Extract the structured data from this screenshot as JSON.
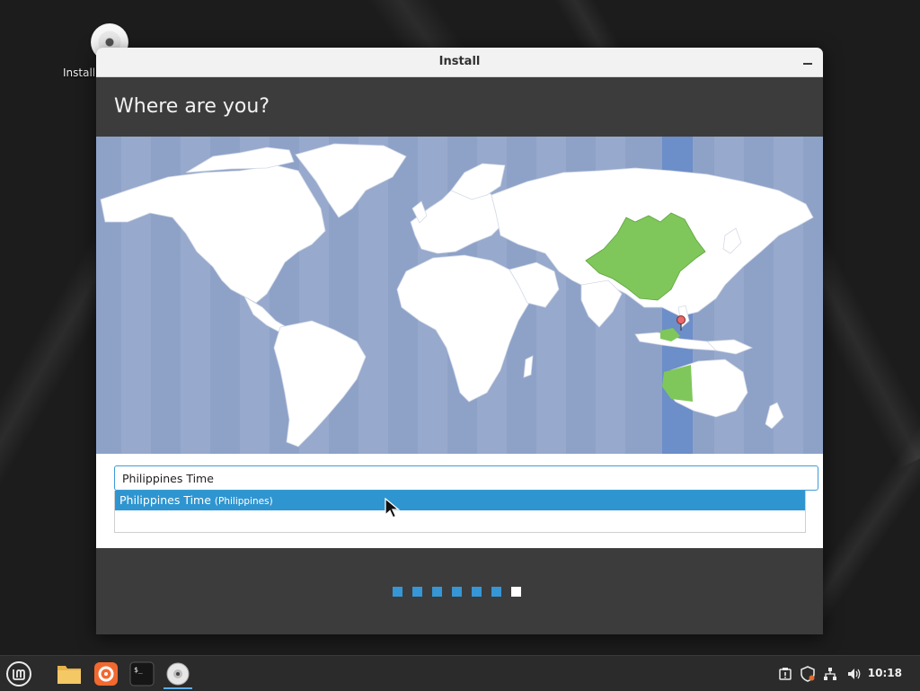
{
  "desktop": {
    "icons": [
      {
        "label": "Install",
        "icon": "disc-icon"
      }
    ]
  },
  "window": {
    "title": "Install",
    "heading": "Where are you?",
    "map": {
      "highlighted_timezone_color": "#6c8ec9",
      "selected_region_color": "#7fc75a",
      "pin_color": "#e86a6a"
    },
    "search": {
      "value": "Philippines Time"
    },
    "results": [
      {
        "name": "Philippines Time",
        "country": "(Philippines)",
        "selected": true
      }
    ],
    "progress": {
      "total_steps": 7,
      "current_step": 7
    }
  },
  "taskbar": {
    "items": [
      {
        "name": "mint-menu-icon"
      },
      {
        "name": "files-icon"
      },
      {
        "name": "firefox-icon"
      },
      {
        "name": "terminal-icon"
      },
      {
        "name": "installer-disc-icon",
        "active": true
      }
    ],
    "tray": [
      "update-manager-icon",
      "shield-icon",
      "network-icon",
      "volume-icon"
    ],
    "clock": "10:18"
  },
  "colors": {
    "accent": "#3696d6",
    "selection": "#2f95d0",
    "window_bg": "#3c3c3c"
  }
}
